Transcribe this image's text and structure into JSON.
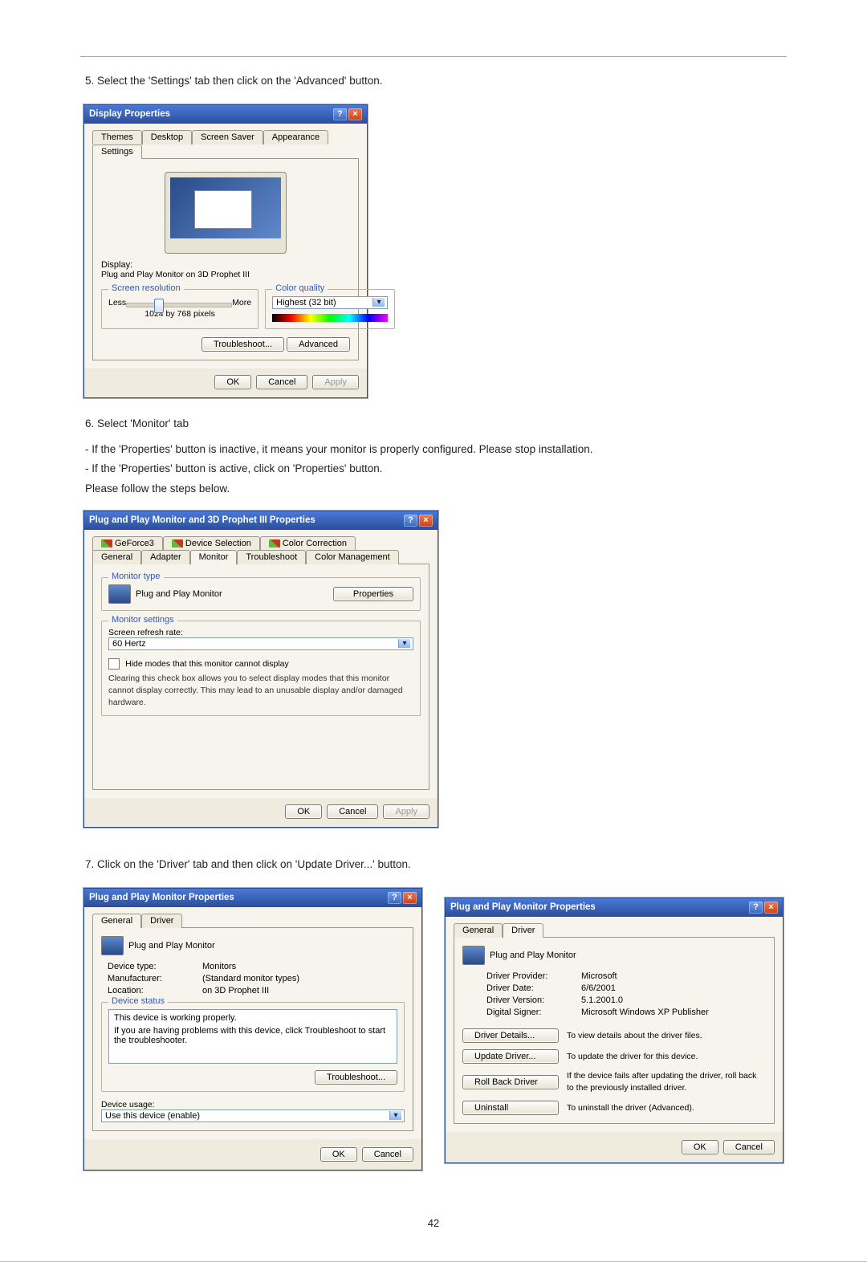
{
  "step5": "5. Select the 'Settings' tab then click on the 'Advanced' button.",
  "step6": "6. Select 'Monitor' tab",
  "step6_n1": "- If the 'Properties' button is inactive, it means your monitor is properly configured. Please stop installation.",
  "step6_n2": "- If the 'Properties' button is active, click on 'Properties' button.",
  "step6_n3": "Please follow the steps below.",
  "step7": "7. Click on the 'Driver' tab and then click on 'Update Driver...' button.",
  "page_number": "42",
  "dlg_display": {
    "title": "Display Properties",
    "tabs": [
      "Themes",
      "Desktop",
      "Screen Saver",
      "Appearance",
      "Settings"
    ],
    "display_label": "Display:",
    "display_value": "Plug and Play Monitor on 3D Prophet III",
    "screen_res_legend": "Screen resolution",
    "less": "Less",
    "more": "More",
    "res_value": "1024 by 768 pixels",
    "color_legend": "Color quality",
    "color_value": "Highest (32 bit)",
    "troubleshoot_btn": "Troubleshoot...",
    "advanced_btn": "Advanced",
    "ok": "OK",
    "cancel": "Cancel",
    "apply": "Apply"
  },
  "dlg_monitor": {
    "title": "Plug and Play Monitor and 3D Prophet III Properties",
    "tabs_row1": [
      "GeForce3",
      "Device Selection",
      "Color Correction"
    ],
    "tabs_row2": [
      "General",
      "Adapter",
      "Monitor",
      "Troubleshoot",
      "Color Management"
    ],
    "monitor_type_legend": "Monitor type",
    "monitor_name": "Plug and Play Monitor",
    "properties_btn": "Properties",
    "monitor_settings_legend": "Monitor settings",
    "refresh_label": "Screen refresh rate:",
    "refresh_value": "60 Hertz",
    "hide_cb": "Hide modes that this monitor cannot display",
    "hide_note": "Clearing this check box allows you to select display modes that this monitor cannot display correctly. This may lead to an unusable display and/or damaged hardware.",
    "ok": "OK",
    "cancel": "Cancel",
    "apply": "Apply"
  },
  "dlg_general": {
    "title": "Plug and Play Monitor Properties",
    "tabs": [
      "General",
      "Driver"
    ],
    "dev_name": "Plug and Play Monitor",
    "device_type_lbl": "Device type:",
    "device_type_val": "Monitors",
    "mfr_lbl": "Manufacturer:",
    "mfr_val": "(Standard monitor types)",
    "loc_lbl": "Location:",
    "loc_val": "on 3D Prophet III",
    "device_status_legend": "Device status",
    "status_line1": "This device is working properly.",
    "status_line2": "If you are having problems with this device, click Troubleshoot to start the troubleshooter.",
    "troubleshoot_btn": "Troubleshoot...",
    "usage_lbl": "Device usage:",
    "usage_val": "Use this device (enable)",
    "ok": "OK",
    "cancel": "Cancel"
  },
  "dlg_driver": {
    "title": "Plug and Play Monitor Properties",
    "tabs": [
      "General",
      "Driver"
    ],
    "dev_name": "Plug and Play Monitor",
    "provider_lbl": "Driver Provider:",
    "provider_val": "Microsoft",
    "date_lbl": "Driver Date:",
    "date_val": "6/6/2001",
    "version_lbl": "Driver Version:",
    "version_val": "5.1.2001.0",
    "signer_lbl": "Digital Signer:",
    "signer_val": "Microsoft Windows XP Publisher",
    "details_btn": "Driver Details...",
    "details_desc": "To view details about the driver files.",
    "update_btn": "Update Driver...",
    "update_desc": "To update the driver for this device.",
    "rollback_btn": "Roll Back Driver",
    "rollback_desc": "If the device fails after updating the driver, roll back to the previously installed driver.",
    "uninstall_btn": "Uninstall",
    "uninstall_desc": "To uninstall the driver (Advanced).",
    "ok": "OK",
    "cancel": "Cancel"
  }
}
